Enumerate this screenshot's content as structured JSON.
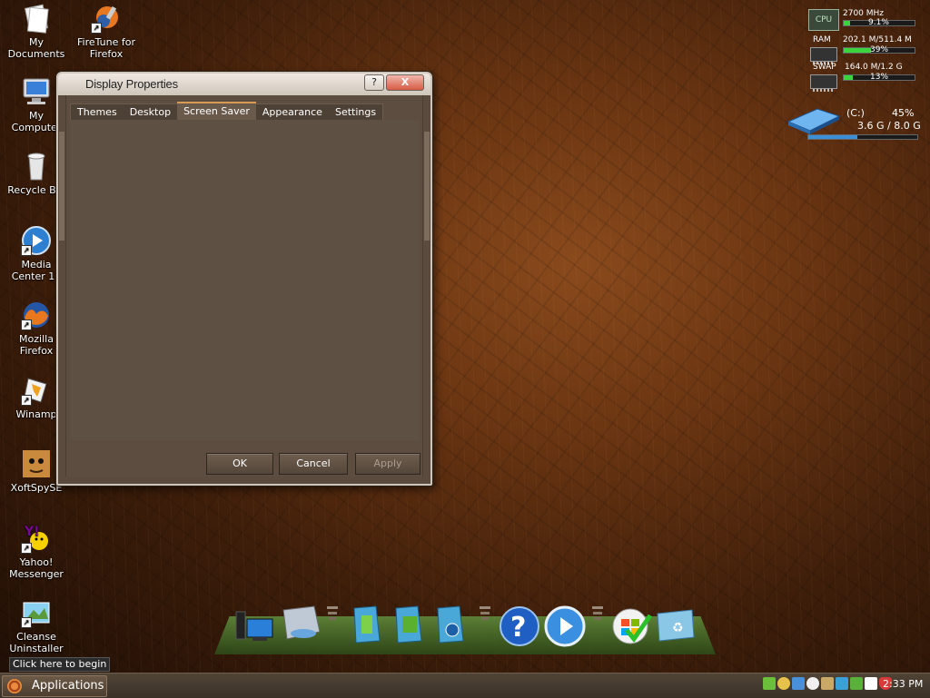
{
  "desktop": {
    "icons": [
      {
        "label": "My\nDocuments"
      },
      {
        "label": "FireTune for\nFirefox"
      },
      {
        "label": "My\nComputer"
      },
      {
        "label": "Recycle Bin"
      },
      {
        "label": "Media\nCenter 13"
      },
      {
        "label": "Mozilla\nFirefox"
      },
      {
        "label": "Winamp"
      },
      {
        "label": "XoftSpySE"
      },
      {
        "label": "Yahoo!\nMessenger"
      },
      {
        "label": "Cleanse\nUninstaller"
      }
    ]
  },
  "dialog": {
    "title": "Display Properties",
    "help_label": "?",
    "close_label": "X",
    "tabs": [
      {
        "label": "Themes"
      },
      {
        "label": "Desktop"
      },
      {
        "label": "Screen Saver"
      },
      {
        "label": "Appearance"
      },
      {
        "label": "Settings"
      }
    ],
    "active_tab": "Screen Saver",
    "ok_label": "OK",
    "cancel_label": "Cancel",
    "apply_label": "Apply"
  },
  "monitor": {
    "cpu": {
      "label": "CPU",
      "freq": "2700 MHz",
      "percent_text": "9.1%",
      "percent": 9.1
    },
    "ram": {
      "label": "RAM",
      "usage": "202.1 M/511.4 M",
      "percent_text": "39%",
      "percent": 39
    },
    "swap": {
      "label": "SWAP",
      "usage": "164.0 M/1.2 G",
      "percent_text": "13%",
      "percent": 13
    },
    "disk": {
      "label": "(C:)",
      "percent_text": "45%",
      "usage": "3.6 G / 8.0 G",
      "percent": 45
    }
  },
  "panel": {
    "apps_label": "Applications",
    "hint": "Click here to begin",
    "clock": "2:33 PM"
  },
  "colors": {
    "accent": "#d89b56",
    "bar_fill": "#3cd43c",
    "disk_fill": "#3b8fd6"
  }
}
